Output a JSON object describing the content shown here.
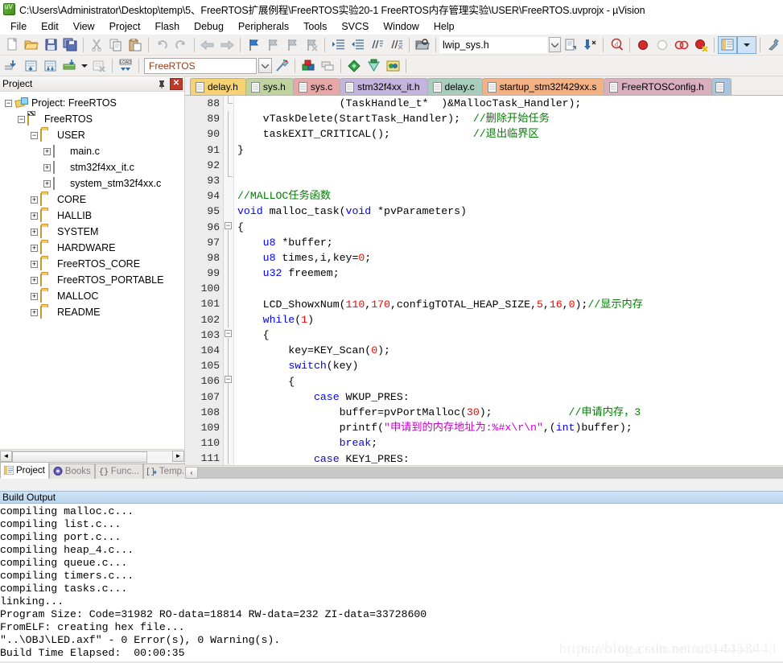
{
  "window": {
    "title": "C:\\Users\\Administrator\\Desktop\\temp\\5、FreeRTOS扩展例程\\FreeRTOS实验20-1 FreeRTOS内存管理实验\\USER\\FreeRTOS.uvprojx - µVision",
    "app_icon": "uvision-icon"
  },
  "menubar": {
    "items": [
      {
        "label": "File"
      },
      {
        "label": "Edit"
      },
      {
        "label": "View"
      },
      {
        "label": "Project"
      },
      {
        "label": "Flash"
      },
      {
        "label": "Debug"
      },
      {
        "label": "Peripherals"
      },
      {
        "label": "Tools"
      },
      {
        "label": "SVCS"
      },
      {
        "label": "Window"
      },
      {
        "label": "Help"
      }
    ]
  },
  "toolbar": {
    "target_value": "FreeRTOS",
    "file_value": "lwip_sys.h",
    "row1_icons": [
      "new-file-icon",
      "open-file-icon",
      "save-icon",
      "save-all-icon",
      "cut-icon",
      "copy-icon",
      "paste-icon",
      "undo-icon",
      "redo-icon",
      "navigate-back-icon",
      "navigate-forward-icon",
      "bookmark-toggle-icon",
      "bookmark-prev-icon",
      "bookmark-next-icon",
      "bookmark-clear-icon",
      "indent-icon",
      "outdent-icon",
      "comment-icon",
      "uncomment-icon"
    ],
    "row2_icons": [
      "build-icon",
      "rebuild-icon",
      "build-all-icon",
      "batch-build-icon",
      "batch-build-dropdown-icon",
      "stop-build-icon",
      "download-icon"
    ],
    "row2_right_icons": [
      "target-dropdown-icon",
      "target-options-icon",
      "manage-project-items-icon",
      "manage-multi-project-icon",
      "configuration-wizard-icon",
      "pack-installer-icon",
      "manage-runtime-icon"
    ],
    "row1_right_icons": [
      "find-in-files-icon",
      "insert-bookmark-icon",
      "goto-definition-icon",
      "search-docs-icon",
      "insert-breakpoint-icon",
      "disable-breakpoint-icon",
      "disable-all-breakpoints-icon",
      "kill-all-breakpoints-icon",
      "project-window-icon",
      "project-window-dropdown-icon",
      "configure-icon"
    ]
  },
  "project_panel": {
    "title": "Project",
    "pin_icon": "pin-icon",
    "close_icon": "close-icon",
    "tree": [
      {
        "label": "Project: FreeRTOS",
        "indent": 0,
        "expander": "-",
        "icon": "project-icon"
      },
      {
        "label": "FreeRTOS",
        "indent": 1,
        "expander": "-",
        "icon": "target-icon"
      },
      {
        "label": "USER",
        "indent": 2,
        "expander": "-",
        "icon": "folder-open-icon"
      },
      {
        "label": "main.c",
        "indent": 3,
        "expander": "+",
        "icon": "c-file-icon"
      },
      {
        "label": "stm32f4xx_it.c",
        "indent": 3,
        "expander": "+",
        "icon": "c-file-icon"
      },
      {
        "label": "system_stm32f4xx.c",
        "indent": 3,
        "expander": "+",
        "icon": "c-file-icon"
      },
      {
        "label": "CORE",
        "indent": 2,
        "expander": "+",
        "icon": "folder-icon"
      },
      {
        "label": "HALLIB",
        "indent": 2,
        "expander": "+",
        "icon": "folder-icon"
      },
      {
        "label": "SYSTEM",
        "indent": 2,
        "expander": "+",
        "icon": "folder-icon"
      },
      {
        "label": "HARDWARE",
        "indent": 2,
        "expander": "+",
        "icon": "folder-icon"
      },
      {
        "label": "FreeRTOS_CORE",
        "indent": 2,
        "expander": "+",
        "icon": "folder-icon"
      },
      {
        "label": "FreeRTOS_PORTABLE",
        "indent": 2,
        "expander": "+",
        "icon": "folder-icon"
      },
      {
        "label": "MALLOC",
        "indent": 2,
        "expander": "+",
        "icon": "folder-icon"
      },
      {
        "label": "README",
        "indent": 2,
        "expander": "+",
        "icon": "folder-icon"
      }
    ],
    "bottom_tabs": [
      {
        "label": "Project",
        "icon": "project-tab-icon",
        "active": true
      },
      {
        "label": "Books",
        "icon": "books-tab-icon",
        "active": false
      },
      {
        "label": "Func...",
        "icon": "functions-tab-icon",
        "active": false
      },
      {
        "label": "Temp...",
        "icon": "templates-tab-icon",
        "active": false
      }
    ]
  },
  "editor": {
    "tabs": [
      {
        "label": "delay.h",
        "color": "#f6d372",
        "active": false
      },
      {
        "label": "sys.h",
        "color": "#bfd3a0",
        "active": false
      },
      {
        "label": "sys.c",
        "color": "#e8a7a7",
        "active": false
      },
      {
        "label": "stm32f4xx_it.h",
        "color": "#c3b4dd",
        "active": false
      },
      {
        "label": "delay.c",
        "color": "#a8cdbf",
        "active": false
      },
      {
        "label": "startup_stm32f429xx.s",
        "color": "#f4b183",
        "active": false
      },
      {
        "label": "FreeRTOSConfig.h",
        "color": "#d9aebf",
        "active": false
      },
      {
        "label": "",
        "color": "#a8c6e0",
        "active": true
      }
    ],
    "first_line": 88,
    "lines": [
      {
        "n": 88,
        "fold": "end",
        "text": "                (TaskHandle_t*  )&MallocTask_Handler);"
      },
      {
        "n": 89,
        "fold": "bar",
        "text": "    vTaskDelete(StartTask_Handler);  //删除开始任务"
      },
      {
        "n": 90,
        "fold": "bar",
        "text": "    taskEXIT_CRITICAL();             //退出临界区"
      },
      {
        "n": 91,
        "fold": "bar",
        "text": "}"
      },
      {
        "n": 92,
        "fold": "none",
        "text": ""
      },
      {
        "n": 93,
        "fold": "endtick",
        "text": ""
      },
      {
        "n": 94,
        "fold": "none",
        "text": "//MALLOC任务函数"
      },
      {
        "n": 95,
        "fold": "none",
        "text": "void malloc_task(void *pvParameters)"
      },
      {
        "n": 96,
        "fold": "start",
        "text": "{"
      },
      {
        "n": 97,
        "fold": "bar",
        "text": "    u8 *buffer;"
      },
      {
        "n": 98,
        "fold": "bar",
        "text": "    u8 times,i,key=0;"
      },
      {
        "n": 99,
        "fold": "bar",
        "text": "    u32 freemem;"
      },
      {
        "n": 100,
        "fold": "bar",
        "text": ""
      },
      {
        "n": 101,
        "fold": "bar",
        "text": "    LCD_ShowxNum(110,170,configTOTAL_HEAP_SIZE,5,16,0);//显示内存"
      },
      {
        "n": 102,
        "fold": "bar",
        "text": "    while(1)"
      },
      {
        "n": 103,
        "fold": "start",
        "text": "    {"
      },
      {
        "n": 104,
        "fold": "bar",
        "text": "        key=KEY_Scan(0);"
      },
      {
        "n": 105,
        "fold": "bar",
        "text": "        switch(key)"
      },
      {
        "n": 106,
        "fold": "start",
        "text": "        {"
      },
      {
        "n": 107,
        "fold": "bar",
        "text": "            case WKUP_PRES:"
      },
      {
        "n": 108,
        "fold": "bar",
        "text": "                buffer=pvPortMalloc(30);            //申请内存，3"
      },
      {
        "n": 109,
        "fold": "bar",
        "text": "                printf(\"申请到的内存地址为:%#x\\r\\n\",(int)buffer);"
      },
      {
        "n": 110,
        "fold": "bar",
        "text": "                break;"
      },
      {
        "n": 111,
        "fold": "bar",
        "text": "            case KEY1_PRES:"
      }
    ]
  },
  "build_output": {
    "title": "Build Output",
    "lines": [
      "compiling malloc.c...",
      "compiling list.c...",
      "compiling port.c...",
      "compiling heap_4.c...",
      "compiling queue.c...",
      "compiling timers.c...",
      "compiling tasks.c...",
      "linking...",
      "Program Size: Code=31982 RO-data=18814 RW-data=232 ZI-data=33728600",
      "FromELF: creating hex file...",
      "\"..\\OBJ\\LED.axf\" - 0 Error(s), 0 Warning(s).",
      "Build Time Elapsed:  00:00:35"
    ]
  },
  "watermark": {
    "text": "https://blog.csdn.net/u014453443",
    "text2": "https://blog.csdn.net/u014453443"
  },
  "colors": {
    "keyword": "#0000ff",
    "comment": "#008000",
    "number": "#ff0000",
    "string": "#cc00cc",
    "accent": "#b9d6ef"
  }
}
